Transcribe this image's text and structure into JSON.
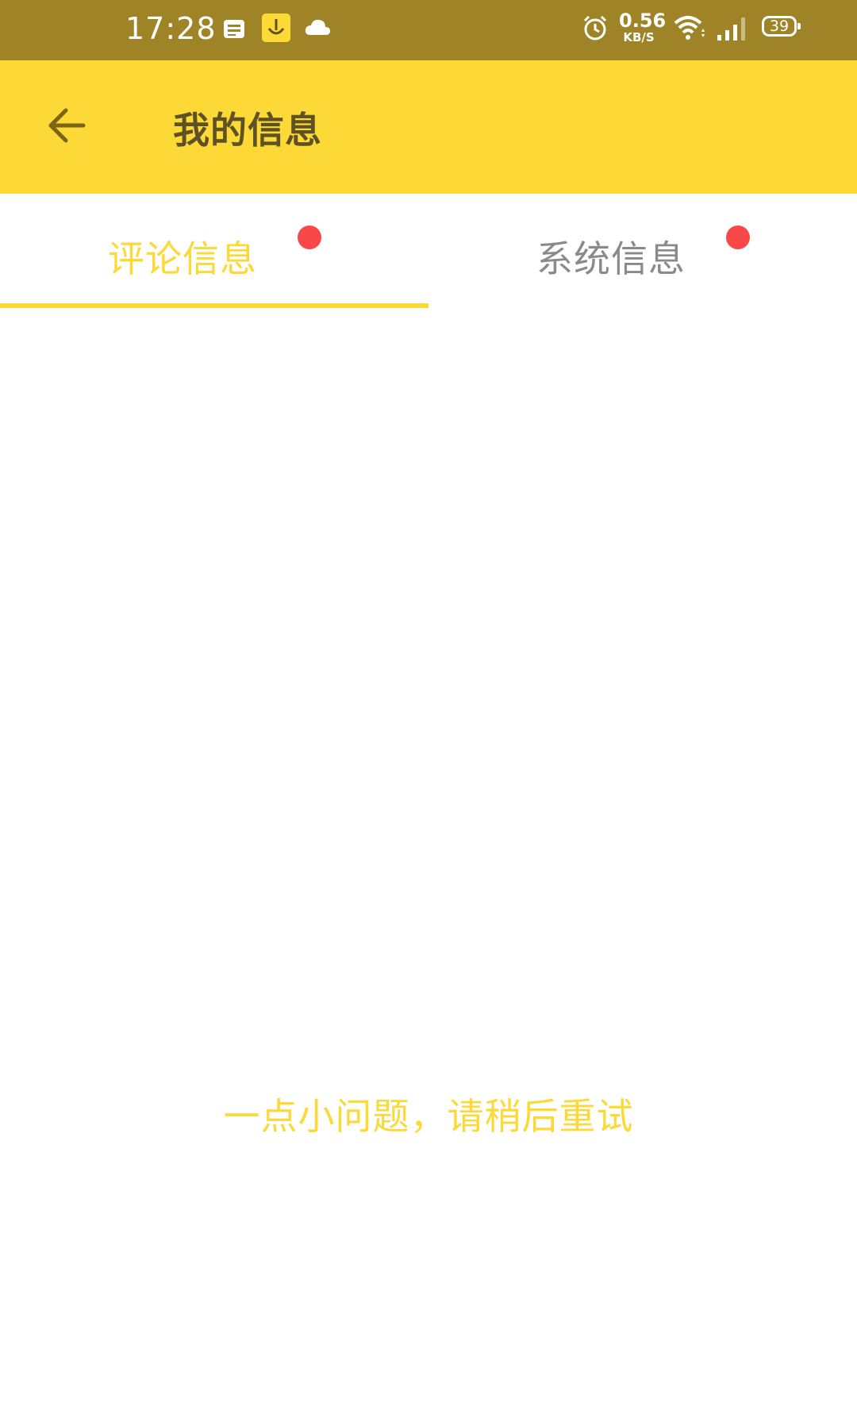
{
  "status_bar": {
    "time": "17:28",
    "net_speed_value": "0.56",
    "net_speed_unit": "KB/S",
    "battery": "39",
    "icons": [
      "message-notification-icon",
      "app-notification-icon",
      "cloud-icon",
      "alarm-icon",
      "wifi-icon",
      "signal-icon",
      "battery-icon"
    ]
  },
  "toolbar": {
    "title": "我的信息",
    "back_icon": "arrow-left-icon"
  },
  "tabs": [
    {
      "label": "评论信息",
      "selected": true,
      "has_badge": true
    },
    {
      "label": "系统信息",
      "selected": false,
      "has_badge": true
    }
  ],
  "content": {
    "error_message": "一点小问题，请稍后重试"
  },
  "colors": {
    "status_bar": "#9e8426",
    "toolbar": "#fdd938",
    "accent": "#fdd938",
    "badge": "#f94848",
    "tab_inactive": "#8a8a8a"
  }
}
